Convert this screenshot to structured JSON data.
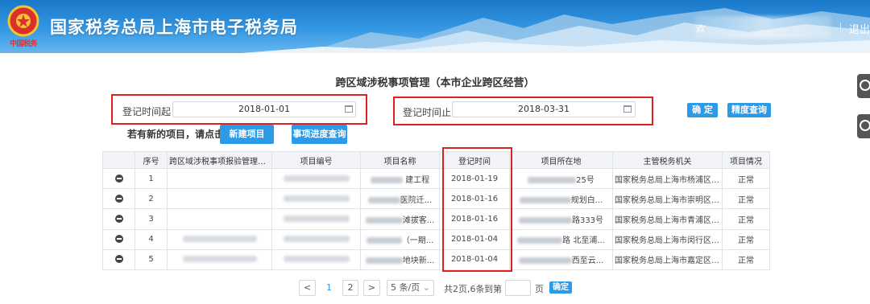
{
  "header": {
    "emblem_text": "中国税务",
    "site_title": "国家税务总局上海市电子税务局",
    "user_prefix": "欢",
    "logout": "退出"
  },
  "page_title": "跨区域涉税事项管理（本市企业跨区经营）",
  "filters": {
    "start_label": "登记时间起：",
    "start_value": "2018-01-01",
    "end_label": "登记时间止：",
    "end_value": "2018-03-31",
    "confirm_label": "确 定",
    "precise_query_label": "精度查询"
  },
  "actions": {
    "hint": "若有新的项目，请点击：",
    "new_project_label": "新建项目",
    "progress_query_label": "事项进度查询"
  },
  "table": {
    "columns": [
      "",
      "序号",
      "跨区域涉税事项报验管理编号",
      "项目编号",
      "项目名称",
      "登记时间",
      "项目所在地",
      "主管税务机关",
      "项目情况"
    ],
    "rows": [
      {
        "seq": "1",
        "name_tail": "建工程",
        "date": "2018-01-19",
        "loc_tail": "25号",
        "authority": "国家税务总局上海市杨浦区税务局",
        "status": "正常"
      },
      {
        "seq": "2",
        "name_tail": "医院迁...",
        "date": "2018-01-16",
        "loc_tail": "规划白...",
        "authority": "国家税务总局上海市崇明区税务局",
        "status": "正常"
      },
      {
        "seq": "3",
        "name_tail": "滩拔客...",
        "date": "2018-01-16",
        "loc_tail": "路333号",
        "authority": "国家税务总局上海市青浦区税务局",
        "status": "正常"
      },
      {
        "seq": "4",
        "name_tail": "（一期...",
        "date": "2018-01-04",
        "loc_tail": "路 北至浦...",
        "authority": "国家税务总局上海市闵行区税务局",
        "status": "正常"
      },
      {
        "seq": "5",
        "name_tail": "地块新...",
        "date": "2018-01-04",
        "loc_tail": "西至云...",
        "authority": "国家税务总局上海市嘉定区税务局",
        "status": "正常"
      }
    ]
  },
  "pagination": {
    "prev": "<",
    "page1": "1",
    "page2": "2",
    "next": ">",
    "page_size": "5 条/页",
    "summary": "共2页,6条",
    "goto_label": "到第",
    "goto_value": "",
    "page_unit": "页",
    "confirm": "确定"
  },
  "colors": {
    "header_blue": "#1a78c9",
    "accent_blue": "#2b9be8",
    "highlight_red": "#e02020"
  }
}
